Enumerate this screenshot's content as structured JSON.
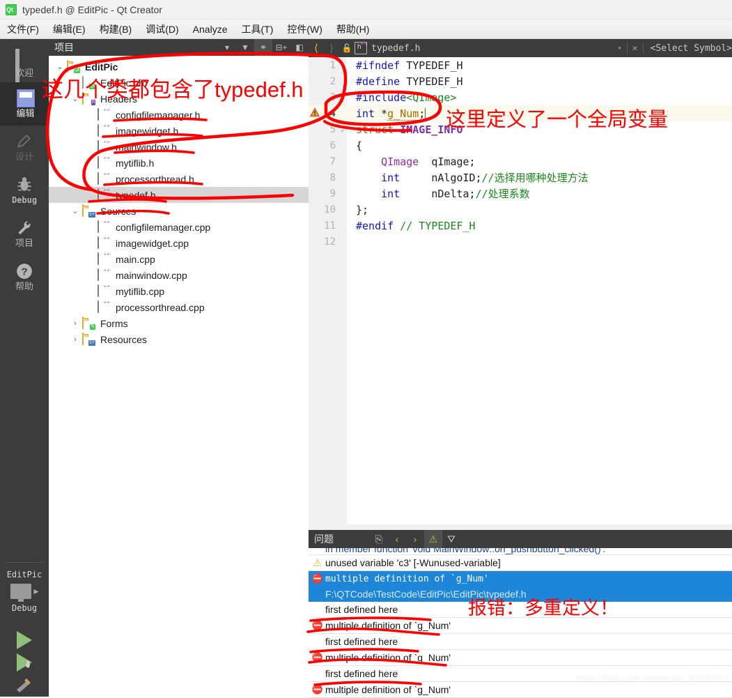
{
  "window": {
    "title": "typedef.h @ EditPic - Qt Creator",
    "app_icon": "qt-logo-icon"
  },
  "menubar": {
    "items": [
      {
        "label": "文件(F)",
        "name": "menu-file"
      },
      {
        "label": "编辑(E)",
        "name": "menu-edit"
      },
      {
        "label": "构建(B)",
        "name": "menu-build"
      },
      {
        "label": "调试(D)",
        "name": "menu-debug"
      },
      {
        "label": "Analyze",
        "name": "menu-analyze"
      },
      {
        "label": "工具(T)",
        "name": "menu-tools"
      },
      {
        "label": "控件(W)",
        "name": "menu-window"
      },
      {
        "label": "帮助(H)",
        "name": "menu-help"
      }
    ]
  },
  "modebar": {
    "items": [
      {
        "label": "欢迎",
        "icon": "grid-icon",
        "state": "normal"
      },
      {
        "label": "编辑",
        "icon": "document-lines-icon",
        "state": "selected"
      },
      {
        "label": "设计",
        "icon": "pencil-icon",
        "state": "disabled"
      },
      {
        "label": "Debug",
        "icon": "bug-icon",
        "state": "normal"
      },
      {
        "label": "项目",
        "icon": "wrench-icon",
        "state": "normal"
      },
      {
        "label": "帮助",
        "icon": "question-mark-icon",
        "state": "normal"
      }
    ],
    "run_config": {
      "project": "EditPic",
      "kit_icon": "monitor-icon",
      "build_config": "Debug",
      "run_label": "run-button",
      "debug_label": "start-debugging-button",
      "build_label": "build-button"
    }
  },
  "project_panel": {
    "title": "项目",
    "toolbar": [
      {
        "name": "filter-dropdown-icon",
        "glyph": "▾"
      },
      {
        "name": "filter-icon",
        "glyph": "▼"
      },
      {
        "name": "synchronize-with-editor-icon",
        "glyph": "⚭",
        "active": true
      },
      {
        "name": "split-icon",
        "glyph": "⊟+"
      },
      {
        "name": "close-panel-icon",
        "glyph": "◧"
      }
    ],
    "tree": [
      {
        "label": "EditPic",
        "depth": 0,
        "icon": "qt-project-folder-icon",
        "expander": "expanded",
        "bold": true
      },
      {
        "label": "EditPic.pro",
        "depth": 1,
        "icon": "qt-pro-file-icon",
        "expander": "none",
        "bold": false
      },
      {
        "label": "Headers",
        "depth": 1,
        "icon": "headers-folder-icon",
        "expander": "expanded",
        "bold": false
      },
      {
        "label": "configfilemanager.h",
        "depth": 2,
        "icon": "header-file-icon",
        "expander": "none",
        "bold": false
      },
      {
        "label": "imagewidget.h",
        "depth": 2,
        "icon": "header-file-icon",
        "expander": "none",
        "bold": false
      },
      {
        "label": "mainwindow.h",
        "depth": 2,
        "icon": "header-file-icon",
        "expander": "none",
        "bold": false
      },
      {
        "label": "mytiflib.h",
        "depth": 2,
        "icon": "header-file-icon",
        "expander": "none",
        "bold": false
      },
      {
        "label": "processorthread.h",
        "depth": 2,
        "icon": "header-file-icon",
        "expander": "none",
        "bold": false
      },
      {
        "label": "typedef.h",
        "depth": 2,
        "icon": "header-file-icon",
        "expander": "none",
        "bold": false,
        "selected": true
      },
      {
        "label": "Sources",
        "depth": 1,
        "icon": "sources-folder-icon",
        "expander": "expanded",
        "bold": false
      },
      {
        "label": "configfilemanager.cpp",
        "depth": 2,
        "icon": "source-file-icon",
        "expander": "none",
        "bold": false
      },
      {
        "label": "imagewidget.cpp",
        "depth": 2,
        "icon": "source-file-icon",
        "expander": "none",
        "bold": false
      },
      {
        "label": "main.cpp",
        "depth": 2,
        "icon": "source-file-icon",
        "expander": "none",
        "bold": false
      },
      {
        "label": "mainwindow.cpp",
        "depth": 2,
        "icon": "source-file-icon",
        "expander": "none",
        "bold": false
      },
      {
        "label": "mytiflib.cpp",
        "depth": 2,
        "icon": "source-file-icon",
        "expander": "none",
        "bold": false
      },
      {
        "label": "processorthread.cpp",
        "depth": 2,
        "icon": "source-file-icon",
        "expander": "none",
        "bold": false
      },
      {
        "label": "Forms",
        "depth": 1,
        "icon": "forms-folder-icon",
        "expander": "collapsed",
        "bold": false
      },
      {
        "label": "Resources",
        "depth": 1,
        "icon": "resources-folder-icon",
        "expander": "collapsed",
        "bold": false
      }
    ]
  },
  "editor": {
    "toolbar": {
      "back_icon": "navigate-back-icon",
      "forward_icon": "navigate-forward-icon",
      "lock_icon": "unlock-icon",
      "file_icon": "header-file-icon",
      "filename": "typedef.h",
      "dropdown_icon": "chevron-down-icon",
      "close_icon": "close-icon",
      "symbol_selector": "<Select Symbol>"
    },
    "lines": [
      {
        "n": "1",
        "fold": "",
        "current": false,
        "marker": "",
        "tokens": [
          {
            "t": "#ifndef ",
            "c": "pp2"
          },
          {
            "t": "TYPEDEF_H",
            "c": ""
          }
        ]
      },
      {
        "n": "2",
        "fold": "",
        "current": false,
        "marker": "",
        "tokens": [
          {
            "t": "#define ",
            "c": "pp2"
          },
          {
            "t": "TYPEDEF_H",
            "c": ""
          }
        ]
      },
      {
        "n": "3",
        "fold": "",
        "current": false,
        "marker": "",
        "tokens": [
          {
            "t": "#include",
            "c": "pp2"
          },
          {
            "t": "<QImage>",
            "c": "str"
          }
        ]
      },
      {
        "n": "4",
        "fold": "",
        "current": true,
        "marker": "warning-icon",
        "tokens": [
          {
            "t": "int ",
            "c": "kw"
          },
          {
            "t": "*",
            "c": ""
          },
          {
            "t": "g_Num",
            "c": "var"
          },
          {
            "t": ";",
            "c": ""
          }
        ]
      },
      {
        "n": "5",
        "fold": "v",
        "current": false,
        "marker": "",
        "tokens": [
          {
            "t": "struct ",
            "c": "fld"
          },
          {
            "t": "IMAGE_INFO",
            "c": "typ"
          }
        ]
      },
      {
        "n": "6",
        "fold": "",
        "current": false,
        "marker": "",
        "tokens": [
          {
            "t": "{",
            "c": ""
          }
        ]
      },
      {
        "n": "7",
        "fold": "",
        "current": false,
        "marker": "",
        "tokens": [
          {
            "t": "    ",
            "c": ""
          },
          {
            "t": "QImage",
            "c": "qcls"
          },
          {
            "t": "  qImage;",
            "c": ""
          }
        ]
      },
      {
        "n": "8",
        "fold": "",
        "current": false,
        "marker": "",
        "tokens": [
          {
            "t": "    ",
            "c": ""
          },
          {
            "t": "int",
            "c": "kw"
          },
          {
            "t": "     nAlgoID;",
            "c": ""
          },
          {
            "t": "//选择用哪种处理方法",
            "c": "cmt"
          }
        ]
      },
      {
        "n": "9",
        "fold": "",
        "current": false,
        "marker": "",
        "tokens": [
          {
            "t": "    ",
            "c": ""
          },
          {
            "t": "int",
            "c": "kw"
          },
          {
            "t": "     nDelta;",
            "c": ""
          },
          {
            "t": "//处理系数",
            "c": "cmt"
          }
        ]
      },
      {
        "n": "10",
        "fold": "",
        "current": false,
        "marker": "",
        "tokens": [
          {
            "t": "};",
            "c": ""
          }
        ]
      },
      {
        "n": "11",
        "fold": "",
        "current": false,
        "marker": "",
        "tokens": [
          {
            "t": "#endif ",
            "c": "pp2"
          },
          {
            "t": "// TYPEDEF_H",
            "c": "cmt"
          }
        ]
      },
      {
        "n": "12",
        "fold": "",
        "current": false,
        "marker": "",
        "tokens": [
          {
            "t": "",
            "c": ""
          }
        ]
      }
    ]
  },
  "issues": {
    "title": "问题",
    "toolbar": [
      {
        "name": "copy-issue-icon",
        "glyph": "⎘"
      },
      {
        "name": "previous-issue-icon",
        "glyph": "‹"
      },
      {
        "name": "next-issue-icon",
        "glyph": "›"
      },
      {
        "name": "warning-filter-icon",
        "glyph": "⚠",
        "active": true
      },
      {
        "name": "filter-icon",
        "glyph": "⛛"
      }
    ],
    "rows": [
      {
        "kind": "context-cut",
        "icon": "",
        "text": "in member function 'void MainWindow::on_pushbutton_clicked()':"
      },
      {
        "kind": "warning",
        "icon": "warning-icon",
        "text": "unused variable 'c3' [-Wunused-variable]"
      },
      {
        "kind": "error-selected",
        "icon": "error-icon",
        "text": "multiple definition of `g_Num'"
      },
      {
        "kind": "path-selected",
        "icon": "",
        "text": "F:\\QTCode\\TestCode\\EditPic\\EditPic\\typedef.h"
      },
      {
        "kind": "plain",
        "icon": "",
        "text": "first defined here"
      },
      {
        "kind": "error",
        "icon": "error-icon",
        "text": "multiple definition of `g_Num'"
      },
      {
        "kind": "plain",
        "icon": "",
        "text": "first defined here"
      },
      {
        "kind": "error",
        "icon": "error-icon",
        "text": "multiple definition of `g_Num'"
      },
      {
        "kind": "plain",
        "icon": "",
        "text": "first defined here"
      },
      {
        "kind": "error",
        "icon": "error-icon",
        "text": "multiple definition of `g_Num'"
      }
    ]
  },
  "annotations": {
    "tree_note": "这几个类都包含了typedef.h",
    "editor_note": "这里定义了一个全局变量",
    "issue_note": "报错：多重定义！"
  },
  "watermark": "https://blog.csdn.net/weixin_43935474",
  "colors": {
    "accent_red": "#fe0000",
    "selection_blue": "#1e86d8",
    "dark_chrome": "#3c3c3c",
    "qt_green": "#41cd52"
  }
}
